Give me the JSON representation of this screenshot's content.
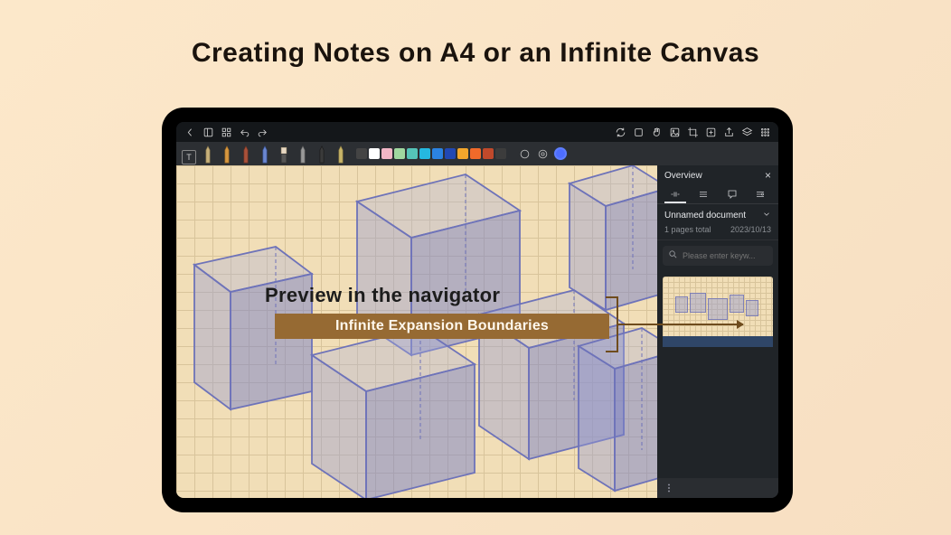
{
  "promo": {
    "title": "Creating Notes on A4 or an Infinite Canvas"
  },
  "topbar_icons": {
    "back": "back-icon",
    "layout": "layout-icon",
    "grid": "grid-icon",
    "undo": "undo-icon",
    "redo": "redo-icon",
    "sync": "sync-icon",
    "square1": "box-icon",
    "hand": "hand-icon",
    "photo": "image-icon",
    "crop": "crop-icon",
    "add": "add-square-icon",
    "share": "share-icon",
    "layers": "layers-icon",
    "menu": "menu-grid-icon"
  },
  "swatches": [
    "#444444",
    "#ffffff",
    "#f2b6c6",
    "#a0d8a0",
    "#55c4b8",
    "#25b8e0",
    "#2b83e2",
    "#2148b4",
    "#f3a62c",
    "#f06a2a",
    "#c0492b",
    "#3c3c3c"
  ],
  "overview": {
    "title": "Overview",
    "doc_name": "Unnamed document",
    "pages_total": "1 pages total",
    "date": "2023/10/13",
    "search_placeholder": "Please enter keyw..."
  },
  "callouts": {
    "preview": "Preview in the navigator",
    "boundaries": "Infinite Expansion Boundaries"
  }
}
